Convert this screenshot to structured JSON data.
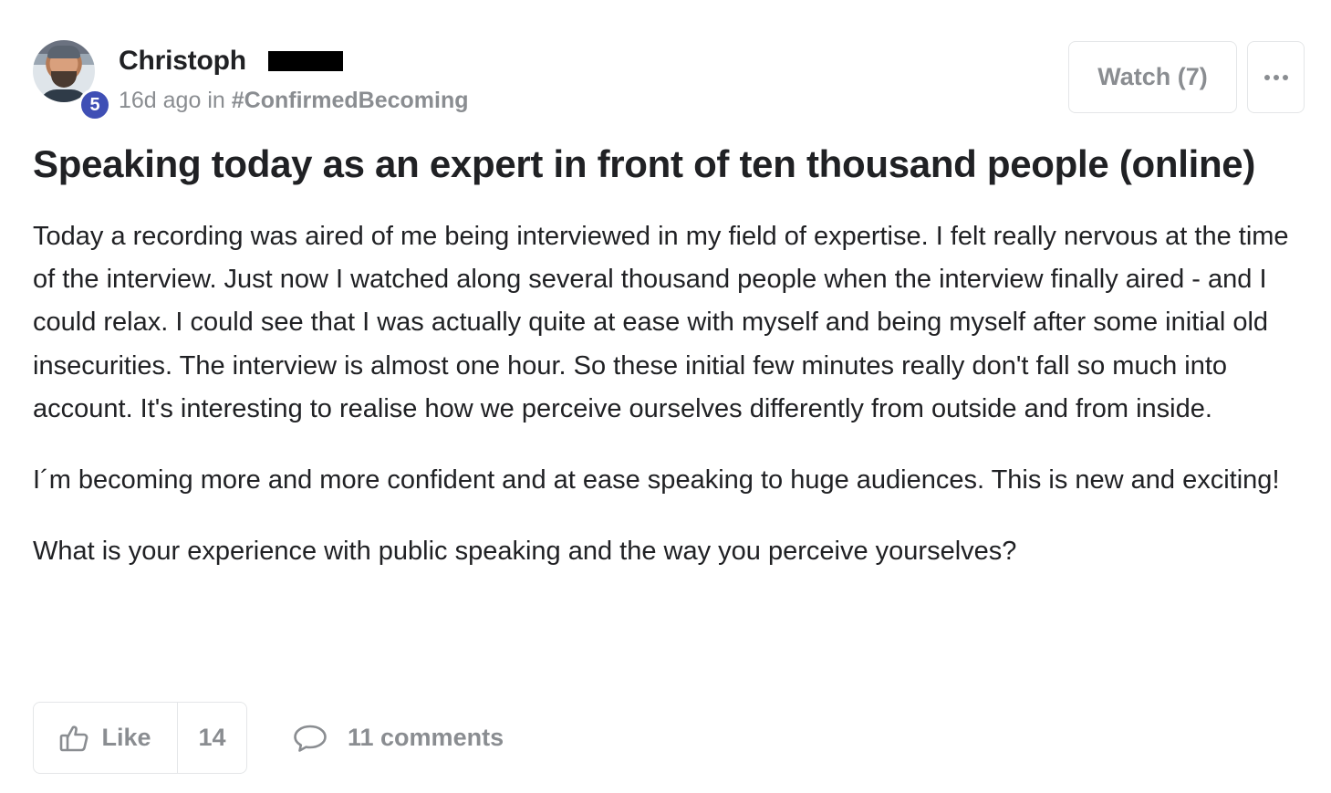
{
  "post": {
    "author": {
      "name": "Christoph",
      "level": "5"
    },
    "meta": {
      "time": "16d ago",
      "in_text": "in",
      "category": "#ConfirmedBecoming"
    },
    "watch_label": "Watch (7)",
    "title": "Speaking today as an expert in front of ten thousand people (online)",
    "paragraphs": [
      "Today a recording was aired of me being interviewed in my field of expertise. I felt really nervous at the time of the interview. Just now I watched along several thousand people when the interview finally aired - and I could relax. I could see that I was actually quite at ease with myself and being myself after some initial old insecurities. The interview is almost one hour. So these initial few minutes really don't fall so much into account. It's interesting to realise how we perceive ourselves differently from outside and from inside.",
      "I´m becoming more and more confident and at ease speaking to huge audiences. This is new and exciting!",
      "What is your experience with public speaking and the way you perceive yourselves?"
    ],
    "actions": {
      "like_label": "Like",
      "like_count": "14",
      "comments_label": "11 comments"
    }
  },
  "colors": {
    "text": "#202124",
    "muted": "#8a8d91",
    "border": "#e4e6e8",
    "badge": "#3f4fb5"
  },
  "icons": [
    "thumbs-up-icon",
    "comment-bubble-icon",
    "more-dots-icon"
  ]
}
